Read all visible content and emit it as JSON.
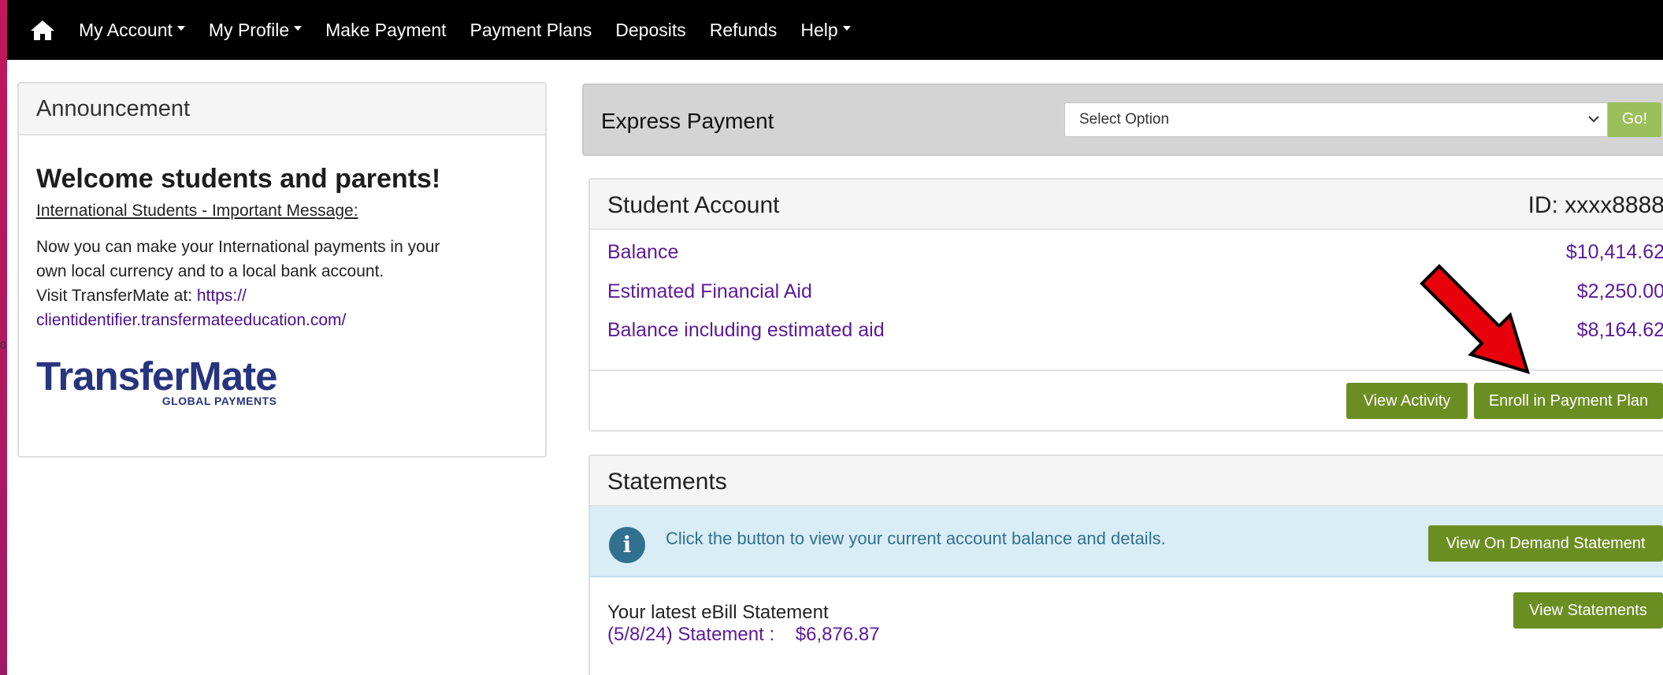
{
  "colors": {
    "navbar": "#000000",
    "link_purple": "#5b1a9b",
    "button_green": "#6b8e23",
    "go_button": "#9bbf5a",
    "info_bg": "#d9edf7",
    "arrow_red": "#e8000b",
    "logo_blue": "#27357e"
  },
  "nav": {
    "home_icon": "home-icon",
    "items": [
      {
        "label": "My Account",
        "dropdown": true
      },
      {
        "label": "My Profile",
        "dropdown": true
      },
      {
        "label": "Make Payment",
        "dropdown": false
      },
      {
        "label": "Payment Plans",
        "dropdown": false
      },
      {
        "label": "Deposits",
        "dropdown": false
      },
      {
        "label": "Refunds",
        "dropdown": false
      },
      {
        "label": "Help",
        "dropdown": true
      }
    ]
  },
  "announcement": {
    "header": "Announcement",
    "title": "Welcome students and parents!",
    "link": "International Students - Important Message:",
    "body_line1": "Now you can make your International payments in your",
    "body_line2": "own local currency and to a local bank account.",
    "body_line3": "Visit TransferMate at: ",
    "url_part1": "https://",
    "url_part2": "clientidentifier.transfermateeducation.com/",
    "logo_word": "TransferMate",
    "logo_sub": "GLOBAL PAYMENTS"
  },
  "express": {
    "label": "Express Payment",
    "select_value": "Select Option",
    "go_label": "Go!"
  },
  "account": {
    "title": "Student Account",
    "id": "ID: xxxx8888",
    "rows": [
      {
        "label": "Balance",
        "value": "$10,414.62"
      },
      {
        "label": "Estimated Financial Aid",
        "value": "$2,250.00"
      },
      {
        "label": "Balance including estimated aid",
        "value": "$8,164.62"
      }
    ],
    "view_activity": "View Activity",
    "enroll": "Enroll in Payment Plan"
  },
  "statements": {
    "title": "Statements",
    "info_text": "Click the button to view your current account balance and details.",
    "on_demand": "View On Demand Statement",
    "latest_label": "Your latest eBill Statement",
    "latest_link": "(5/8/24) Statement :    $6,876.87",
    "view_statements": "View Statements"
  },
  "edge_mark": "0"
}
